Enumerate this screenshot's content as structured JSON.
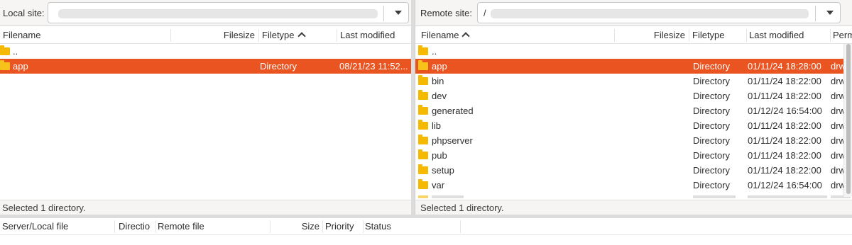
{
  "local": {
    "site_label": "Local site:",
    "site_value": "",
    "columns": {
      "filename": "Filename",
      "filesize": "Filesize",
      "filetype": "Filetype",
      "last_modified": "Last modified"
    },
    "sort_column": "filetype",
    "rows": [
      {
        "name": "..",
        "size": "",
        "type": "",
        "modified": "",
        "selected": false
      },
      {
        "name": "app",
        "size": "",
        "type": "Directory",
        "modified": "08/21/23 11:52...",
        "selected": true
      }
    ],
    "status": "Selected 1 directory."
  },
  "remote": {
    "site_label": "Remote site:",
    "site_value": "/",
    "columns": {
      "filename": "Filename",
      "filesize": "Filesize",
      "filetype": "Filetype",
      "last_modified": "Last modified",
      "permissions": "Perm"
    },
    "sort_column": "filename",
    "rows": [
      {
        "name": "..",
        "size": "",
        "type": "",
        "modified": "",
        "perm": "",
        "selected": false
      },
      {
        "name": "app",
        "size": "",
        "type": "Directory",
        "modified": "01/11/24 18:28:00",
        "perm": "drwx",
        "selected": true
      },
      {
        "name": "bin",
        "size": "",
        "type": "Directory",
        "modified": "01/11/24 18:22:00",
        "perm": "drwx",
        "selected": false
      },
      {
        "name": "dev",
        "size": "",
        "type": "Directory",
        "modified": "01/11/24 18:22:00",
        "perm": "drwx",
        "selected": false
      },
      {
        "name": "generated",
        "size": "",
        "type": "Directory",
        "modified": "01/12/24 16:54:00",
        "perm": "drwx",
        "selected": false
      },
      {
        "name": "lib",
        "size": "",
        "type": "Directory",
        "modified": "01/11/24 18:22:00",
        "perm": "drwx",
        "selected": false
      },
      {
        "name": "phpserver",
        "size": "",
        "type": "Directory",
        "modified": "01/11/24 18:22:00",
        "perm": "drwx",
        "selected": false
      },
      {
        "name": "pub",
        "size": "",
        "type": "Directory",
        "modified": "01/11/24 18:22:00",
        "perm": "drwx",
        "selected": false
      },
      {
        "name": "setup",
        "size": "",
        "type": "Directory",
        "modified": "01/11/24 18:22:00",
        "perm": "drwx",
        "selected": false
      },
      {
        "name": "var",
        "size": "",
        "type": "Directory",
        "modified": "01/12/24 16:54:00",
        "perm": "drwx",
        "selected": false
      }
    ],
    "status": "Selected 1 directory."
  },
  "queue": {
    "columns": {
      "server_local": "Server/Local file",
      "direction": "Directio",
      "remote_file": "Remote file",
      "size": "Size",
      "priority": "Priority",
      "status": "Status"
    }
  },
  "colors": {
    "selection": "#e95420",
    "folder": "#f5b900"
  },
  "icons": {
    "folder": "folder-icon",
    "dropdown": "chevron-down-icon",
    "sort": "sort-ascending-icon"
  }
}
